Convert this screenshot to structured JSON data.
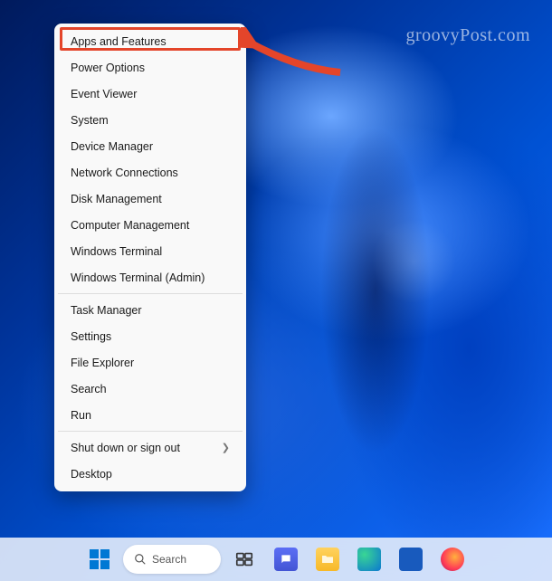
{
  "watermark": "groovyPost.com",
  "menu": {
    "group1": [
      "Apps and Features",
      "Power Options",
      "Event Viewer",
      "System",
      "Device Manager",
      "Network Connections",
      "Disk Management",
      "Computer Management",
      "Windows Terminal",
      "Windows Terminal (Admin)"
    ],
    "group2": [
      "Task Manager",
      "Settings",
      "File Explorer",
      "Search",
      "Run"
    ],
    "group3": [
      {
        "label": "Shut down or sign out",
        "submenu": true
      },
      {
        "label": "Desktop",
        "submenu": false
      }
    ]
  },
  "taskbar": {
    "search_label": "Search"
  }
}
